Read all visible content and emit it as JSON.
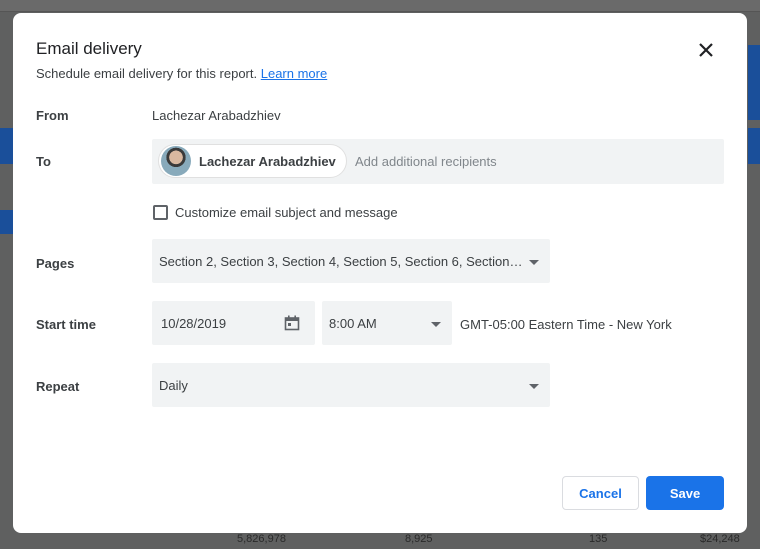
{
  "dialog": {
    "title": "Email delivery",
    "subtitle": "Schedule email delivery for this report.",
    "learn_more": "Learn more"
  },
  "from": {
    "label": "From",
    "value": "Lachezar Arabadzhiev"
  },
  "to": {
    "label": "To",
    "recipient": "Lachezar Arabadzhiev",
    "placeholder": "Add additional recipients"
  },
  "customize": {
    "label": "Customize email subject and message",
    "checked": false
  },
  "pages": {
    "label": "Pages",
    "value": "Section 2, Section 3, Section 4, Section 5, Section 6, Section…"
  },
  "start_time": {
    "label": "Start time",
    "date": "10/28/2019",
    "time": "8:00 AM",
    "timezone": "GMT-05:00 Eastern Time - New York"
  },
  "repeat": {
    "label": "Repeat",
    "value": "Daily"
  },
  "buttons": {
    "cancel": "Cancel",
    "save": "Save"
  },
  "background_row": [
    "5,826,978",
    "8,925",
    "135",
    "$24,248"
  ]
}
